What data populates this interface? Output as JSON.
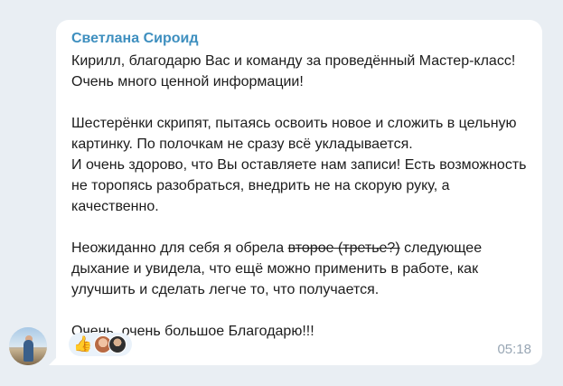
{
  "message": {
    "sender": "Светлана Сироид",
    "paragraph1": "Кирилл, благодарю Вас и команду за проведённый Мастер-класс! Очень много ценной информации!",
    "paragraph2": "Шестерёнки скрипят, пытаясь освоить новое и сложить в цельную картинку. По полочкам не сразу всё укладывается.\nИ очень здорово, что Вы оставляете нам записи! Есть возможность не торопясь разобраться, внедрить не на скорую руку, а качественно.",
    "paragraph3_before": "Неожиданно для себя я обрела ",
    "paragraph3_strike": "второе (третье?)",
    "paragraph3_after": " следующее дыхание и увидела, что ещё можно применить в работе, как улучшить и сделать легче то, что получается.",
    "paragraph4": "Очень, очень большое Благодарю!!!",
    "time": "05:18"
  },
  "reactions": {
    "emoji": "👍",
    "icon": "thumbs-up-icon"
  },
  "colors": {
    "background": "#e9eef3",
    "bubble": "#ffffff",
    "sender": "#3e8fbf",
    "time": "#98a6b4",
    "reaction_bg": "#eaf2fa"
  }
}
